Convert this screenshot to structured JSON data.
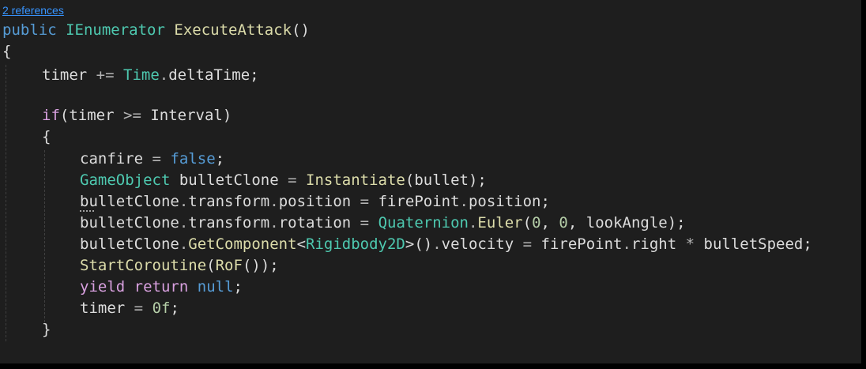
{
  "codelens": {
    "text": "2 references"
  },
  "colors": {
    "background": "#1e1e1e",
    "keyword": "#569cd6",
    "control_keyword": "#d8a0df",
    "type": "#4ec9b0",
    "method": "#dcdcaa",
    "variable": "#dcdcdc",
    "identifier": "#9cdcfe",
    "number": "#b5cea8",
    "link": "#3794ff"
  },
  "lines": {
    "l1": {
      "public": "public",
      "type": "IEnumerator",
      "name": "ExecuteAttack",
      "paren": "()"
    },
    "l2": {
      "brace": "{"
    },
    "l3": {
      "timer": "timer",
      "op": "+=",
      "time": "Time",
      "dot": ".",
      "delta": "deltaTime",
      "semi": ";"
    },
    "l4": {},
    "l5": {
      "kw": "if",
      "open": "(",
      "timer": "timer",
      "op": ">=",
      "interval": "Interval",
      "close": ")"
    },
    "l6": {
      "brace": "{"
    },
    "l7": {
      "var": "canfire",
      "op": "=",
      "val": "false",
      "semi": ";"
    },
    "l8": {
      "type": "GameObject",
      "var": "bulletClone",
      "op": "=",
      "method": "Instantiate",
      "open": "(",
      "arg": "bullet",
      "close": ");"
    },
    "l9": {
      "obj": "bulletClone",
      "d1": ".",
      "prop1": "transform",
      "d2": ".",
      "prop2": "position",
      "op": "=",
      "src": "firePoint",
      "d3": ".",
      "prop3": "position",
      "semi": ";"
    },
    "l10": {
      "obj": "bulletClone",
      "d1": ".",
      "prop1": "transform",
      "d2": ".",
      "prop2": "rotation",
      "op": "=",
      "type": "Quaternion",
      "d3": ".",
      "method": "Euler",
      "open": "(",
      "n1": "0",
      "c1": ", ",
      "n2": "0",
      "c2": ", ",
      "arg": "lookAngle",
      "close": ");"
    },
    "l11": {
      "obj": "bulletClone",
      "d1": ".",
      "method": "GetComponent",
      "lt": "<",
      "type": "Rigidbody2D",
      "gt": ">",
      "call": "()",
      "d2": ".",
      "prop": "velocity",
      "op": "=",
      "src": "firePoint",
      "d3": ".",
      "prop2": "right",
      "mul": "*",
      "speed": "bulletSpeed",
      "semi": ";"
    },
    "l12": {
      "method": "StartCoroutine",
      "open": "(",
      "inner": "RoF",
      "close": "());"
    },
    "l13": {
      "yield": "yield",
      "ret": "return",
      "nul": "null",
      "semi": ";"
    },
    "l14": {
      "var": "timer",
      "op": "=",
      "num": "0f",
      "semi": ";"
    },
    "l15": {
      "brace": "}"
    }
  }
}
